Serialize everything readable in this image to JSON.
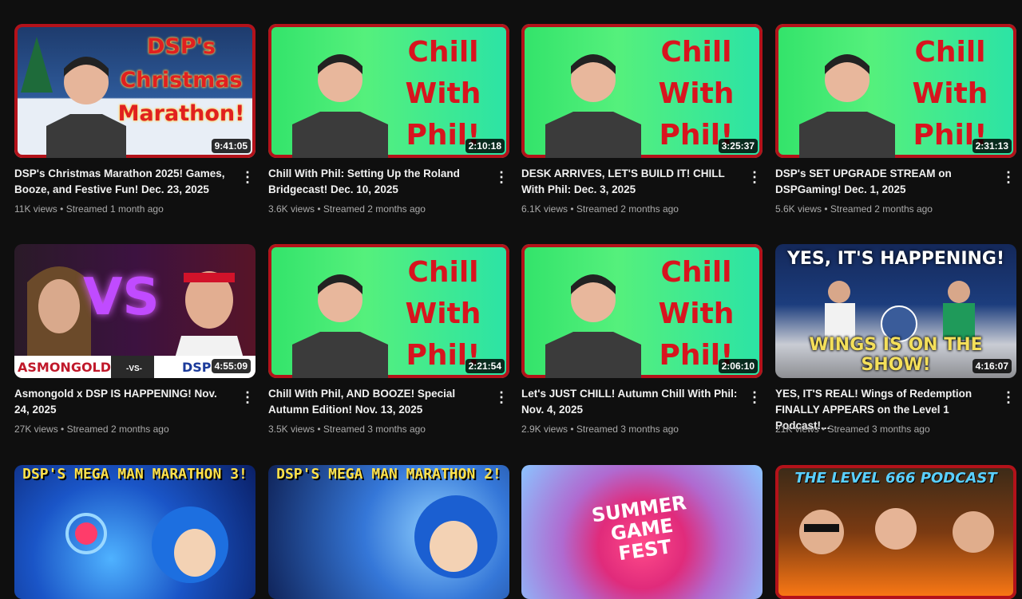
{
  "videos": [
    {
      "title": "DSP's Christmas Marathon 2025! Games, Booze, and Festive Fun! Dec. 23, 2025",
      "views": "11K views",
      "age": "Streamed 1 month ago",
      "duration": "9:41:05",
      "thumb_text": "DSP's Christmas Marathon!"
    },
    {
      "title": "Chill With Phil: Setting Up the Roland Bridgecast! Dec. 10, 2025",
      "views": "3.6K views",
      "age": "Streamed 2 months ago",
      "duration": "2:10:18",
      "thumb_text": "Chill With Phil!"
    },
    {
      "title": "DESK ARRIVES, LET'S BUILD IT! CHILL With Phil: Dec. 3, 2025",
      "views": "6.1K views",
      "age": "Streamed 2 months ago",
      "duration": "3:25:37",
      "thumb_text": "Chill With Phil!"
    },
    {
      "title": "DSP's SET UPGRADE STREAM on DSPGaming! Dec. 1, 2025",
      "views": "5.6K views",
      "age": "Streamed 2 months ago",
      "duration": "2:31:13",
      "thumb_text": "Chill With Phil!"
    },
    {
      "title": "Asmongold x DSP IS HAPPENING! Nov. 24, 2025",
      "views": "27K views",
      "age": "Streamed 2 months ago",
      "duration": "4:55:09",
      "thumb_text": "VS",
      "thumb_left": "ASMONGOLD",
      "thumb_mid": "-VS-",
      "thumb_right": "DSP"
    },
    {
      "title": "Chill With Phil, AND BOOZE! Special Autumn Edition! Nov. 13, 2025",
      "views": "3.5K views",
      "age": "Streamed 3 months ago",
      "duration": "2:21:54",
      "thumb_text": "Chill With Phil!"
    },
    {
      "title": "Let's JUST CHILL! Autumn Chill With Phil: Nov. 4, 2025",
      "views": "2.9K views",
      "age": "Streamed 3 months ago",
      "duration": "2:06:10",
      "thumb_text": "Chill With Phil!"
    },
    {
      "title": "YES, IT'S REAL! Wings of Redemption FINALLY APPEARS on the Level 1 Podcast!...",
      "views": "21K views",
      "age": "Streamed 3 months ago",
      "duration": "4:16:07",
      "thumb_text": "YES, IT'S HAPPENING!",
      "thumb_bottom": "WINGS IS ON THE SHOW!"
    },
    {
      "thumb_text": "DSP'S MEGA MAN MARATHON 3!"
    },
    {
      "thumb_text": "DSP'S MEGA MAN MARATHON 2!"
    },
    {
      "thumb_text": "SUMMER GAME FEST"
    },
    {
      "thumb_text": "THE LEVEL 666 PODCAST"
    }
  ],
  "meta_separator": " • ",
  "kebab_icon": "⋮",
  "colors": {
    "background": "#0f0f0f",
    "frame": "#b3121a",
    "chill_text": "#d8141e",
    "meta_text": "#aaaaaa"
  }
}
